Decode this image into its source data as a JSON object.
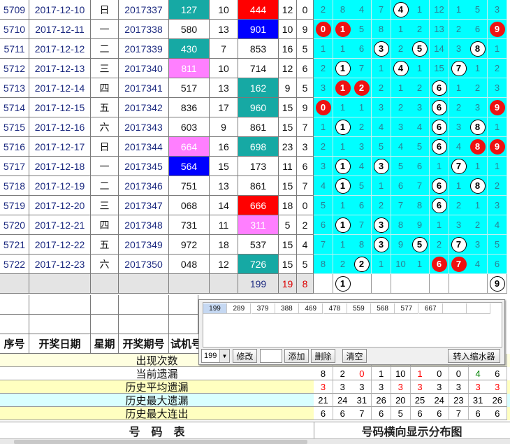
{
  "rows": [
    {
      "seq": "5709",
      "date": "2017-12-10",
      "week": "日",
      "period": "2017337",
      "t1": "127",
      "t1c": "teal",
      "t2": "10",
      "t3": "444",
      "t3c": "red",
      "s": "12",
      "k": "0",
      "dist": [
        {
          "v": "2"
        },
        {
          "v": "8"
        },
        {
          "v": "4"
        },
        {
          "v": "7"
        },
        {
          "v": "4",
          "b": "w"
        },
        {
          "v": "1"
        },
        {
          "v": "12"
        },
        {
          "v": "1"
        },
        {
          "v": "5"
        },
        {
          "v": "3"
        }
      ]
    },
    {
      "seq": "5710",
      "date": "2017-12-11",
      "week": "一",
      "period": "2017338",
      "t1": "580",
      "t1c": "",
      "t2": "13",
      "t3": "901",
      "t3c": "blue",
      "s": "10",
      "k": "9",
      "dist": [
        {
          "v": "0",
          "b": "r"
        },
        {
          "v": "1",
          "b": "r"
        },
        {
          "v": "5"
        },
        {
          "v": "8"
        },
        {
          "v": "1"
        },
        {
          "v": "2"
        },
        {
          "v": "13"
        },
        {
          "v": "2"
        },
        {
          "v": "6"
        },
        {
          "v": "9",
          "b": "r"
        }
      ]
    },
    {
      "seq": "5711",
      "date": "2017-12-12",
      "week": "二",
      "period": "2017339",
      "t1": "430",
      "t1c": "teal",
      "t2": "7",
      "t3": "853",
      "t3c": "",
      "s": "16",
      "k": "5",
      "dist": [
        {
          "v": "1"
        },
        {
          "v": "1"
        },
        {
          "v": "6"
        },
        {
          "v": "3",
          "b": "w"
        },
        {
          "v": "2"
        },
        {
          "v": "5",
          "b": "w"
        },
        {
          "v": "14"
        },
        {
          "v": "3"
        },
        {
          "v": "8",
          "b": "w"
        },
        {
          "v": "1"
        }
      ]
    },
    {
      "seq": "5712",
      "date": "2017-12-13",
      "week": "三",
      "period": "2017340",
      "t1": "811",
      "t1c": "pink",
      "t2": "10",
      "t3": "714",
      "t3c": "",
      "s": "12",
      "k": "6",
      "dist": [
        {
          "v": "2"
        },
        {
          "v": "1",
          "b": "w"
        },
        {
          "v": "7"
        },
        {
          "v": "1"
        },
        {
          "v": "4",
          "b": "w"
        },
        {
          "v": "1"
        },
        {
          "v": "15"
        },
        {
          "v": "7",
          "b": "w"
        },
        {
          "v": "1"
        },
        {
          "v": "2"
        }
      ]
    },
    {
      "seq": "5713",
      "date": "2017-12-14",
      "week": "四",
      "period": "2017341",
      "t1": "517",
      "t1c": "",
      "t2": "13",
      "t3": "162",
      "t3c": "teal",
      "s": "9",
      "k": "5",
      "dist": [
        {
          "v": "3"
        },
        {
          "v": "1",
          "b": "r"
        },
        {
          "v": "2",
          "b": "r"
        },
        {
          "v": "2"
        },
        {
          "v": "1"
        },
        {
          "v": "2"
        },
        {
          "v": "6",
          "b": "w"
        },
        {
          "v": "1"
        },
        {
          "v": "2"
        },
        {
          "v": "3"
        }
      ]
    },
    {
      "seq": "5714",
      "date": "2017-12-15",
      "week": "五",
      "period": "2017342",
      "t1": "836",
      "t1c": "",
      "t2": "17",
      "t3": "960",
      "t3c": "teal",
      "s": "15",
      "k": "9",
      "dist": [
        {
          "v": "0",
          "b": "r"
        },
        {
          "v": "1"
        },
        {
          "v": "1"
        },
        {
          "v": "3"
        },
        {
          "v": "2"
        },
        {
          "v": "3"
        },
        {
          "v": "6",
          "b": "w"
        },
        {
          "v": "2"
        },
        {
          "v": "3"
        },
        {
          "v": "9",
          "b": "r"
        }
      ]
    },
    {
      "seq": "5715",
      "date": "2017-12-16",
      "week": "六",
      "period": "2017343",
      "t1": "603",
      "t1c": "",
      "t2": "9",
      "t3": "861",
      "t3c": "",
      "s": "15",
      "k": "7",
      "dist": [
        {
          "v": "1"
        },
        {
          "v": "1",
          "b": "w"
        },
        {
          "v": "2"
        },
        {
          "v": "4"
        },
        {
          "v": "3"
        },
        {
          "v": "4"
        },
        {
          "v": "6",
          "b": "w"
        },
        {
          "v": "3"
        },
        {
          "v": "8",
          "b": "w"
        },
        {
          "v": "1"
        }
      ]
    },
    {
      "seq": "5716",
      "date": "2017-12-17",
      "week": "日",
      "period": "2017344",
      "t1": "664",
      "t1c": "pink",
      "t2": "16",
      "t3": "698",
      "t3c": "teal",
      "s": "23",
      "k": "3",
      "dist": [
        {
          "v": "2"
        },
        {
          "v": "1"
        },
        {
          "v": "3"
        },
        {
          "v": "5"
        },
        {
          "v": "4"
        },
        {
          "v": "5"
        },
        {
          "v": "6",
          "b": "w"
        },
        {
          "v": "4"
        },
        {
          "v": "8",
          "b": "r"
        },
        {
          "v": "9",
          "b": "r"
        }
      ]
    },
    {
      "seq": "5717",
      "date": "2017-12-18",
      "week": "一",
      "period": "2017345",
      "t1": "564",
      "t1c": "blue",
      "t2": "15",
      "t3": "173",
      "t3c": "",
      "s": "11",
      "k": "6",
      "dist": [
        {
          "v": "3"
        },
        {
          "v": "1",
          "b": "w"
        },
        {
          "v": "4"
        },
        {
          "v": "3",
          "b": "w"
        },
        {
          "v": "5"
        },
        {
          "v": "6"
        },
        {
          "v": "1"
        },
        {
          "v": "7",
          "b": "w"
        },
        {
          "v": "1"
        },
        {
          "v": "1"
        }
      ]
    },
    {
      "seq": "5718",
      "date": "2017-12-19",
      "week": "二",
      "period": "2017346",
      "t1": "751",
      "t1c": "",
      "t2": "13",
      "t3": "861",
      "t3c": "",
      "s": "15",
      "k": "7",
      "dist": [
        {
          "v": "4"
        },
        {
          "v": "1",
          "b": "w"
        },
        {
          "v": "5"
        },
        {
          "v": "1"
        },
        {
          "v": "6"
        },
        {
          "v": "7"
        },
        {
          "v": "6",
          "b": "w"
        },
        {
          "v": "1"
        },
        {
          "v": "8",
          "b": "w"
        },
        {
          "v": "2"
        }
      ]
    },
    {
      "seq": "5719",
      "date": "2017-12-20",
      "week": "三",
      "period": "2017347",
      "t1": "068",
      "t1c": "",
      "t2": "14",
      "t3": "666",
      "t3c": "red",
      "s": "18",
      "k": "0",
      "dist": [
        {
          "v": "5"
        },
        {
          "v": "1"
        },
        {
          "v": "6"
        },
        {
          "v": "2"
        },
        {
          "v": "7"
        },
        {
          "v": "8"
        },
        {
          "v": "6",
          "b": "w"
        },
        {
          "v": "2"
        },
        {
          "v": "1"
        },
        {
          "v": "3"
        }
      ]
    },
    {
      "seq": "5720",
      "date": "2017-12-21",
      "week": "四",
      "period": "2017348",
      "t1": "731",
      "t1c": "",
      "t2": "11",
      "t3": "311",
      "t3c": "pink",
      "s": "5",
      "k": "2",
      "dist": [
        {
          "v": "6"
        },
        {
          "v": "1",
          "b": "w"
        },
        {
          "v": "7"
        },
        {
          "v": "3",
          "b": "w"
        },
        {
          "v": "8"
        },
        {
          "v": "9"
        },
        {
          "v": "1"
        },
        {
          "v": "3"
        },
        {
          "v": "2"
        },
        {
          "v": "4"
        }
      ]
    },
    {
      "seq": "5721",
      "date": "2017-12-22",
      "week": "五",
      "period": "2017349",
      "t1": "972",
      "t1c": "",
      "t2": "18",
      "t3": "537",
      "t3c": "",
      "s": "15",
      "k": "4",
      "dist": [
        {
          "v": "7"
        },
        {
          "v": "1"
        },
        {
          "v": "8"
        },
        {
          "v": "3",
          "b": "w"
        },
        {
          "v": "9"
        },
        {
          "v": "5",
          "b": "w"
        },
        {
          "v": "2"
        },
        {
          "v": "7",
          "b": "w"
        },
        {
          "v": "3"
        },
        {
          "v": "5"
        }
      ]
    },
    {
      "seq": "5722",
      "date": "2017-12-23",
      "week": "六",
      "period": "2017350",
      "t1": "048",
      "t1c": "",
      "t2": "12",
      "t3": "726",
      "t3c": "teal",
      "s": "15",
      "k": "5",
      "dist": [
        {
          "v": "8"
        },
        {
          "v": "2"
        },
        {
          "v": "2",
          "b": "w"
        },
        {
          "v": "1"
        },
        {
          "v": "10"
        },
        {
          "v": "1"
        },
        {
          "v": "6",
          "b": "r"
        },
        {
          "v": "7",
          "b": "r"
        },
        {
          "v": "4"
        },
        {
          "v": "6"
        }
      ]
    }
  ],
  "summary_row": {
    "t3": "199",
    "s": "19",
    "k": "8",
    "balls": [
      {
        "col": 1,
        "v": "1"
      },
      {
        "col": 9,
        "v": "9"
      }
    ]
  },
  "header": [
    "序号",
    "开奖日期",
    "星期",
    "开奖期号",
    "试机号"
  ],
  "stats": [
    {
      "label": "出现次数",
      "bg": "#ffffe0",
      "values": [],
      "colors": []
    },
    {
      "label": "当前遗漏",
      "bg": "#ffffff",
      "values": [
        "8",
        "2",
        "0",
        "1",
        "10",
        "1",
        "0",
        "0",
        "4",
        "6"
      ],
      "colors": [
        "#000000",
        "#000000",
        "#ff0000",
        "#000000",
        "#000000",
        "#ff0000",
        "#000000",
        "#000000",
        "#008000",
        "#000000"
      ]
    },
    {
      "label": "历史平均遗漏",
      "bg": "#ffffc0",
      "values": [
        "3",
        "3",
        "3",
        "3",
        "3",
        "3",
        "3",
        "3",
        "3",
        "3"
      ],
      "colors": [
        "#ff0000",
        "#000000",
        "#000000",
        "#000000",
        "#ff0000",
        "#ff0000",
        "#000000",
        "#000000",
        "#ff0000",
        "#ff0000"
      ]
    },
    {
      "label": "历史最大遗漏",
      "bg": "#d9ffff",
      "values": [
        "21",
        "24",
        "31",
        "26",
        "20",
        "25",
        "24",
        "23",
        "31",
        "26"
      ],
      "colors": [
        "#000000",
        "#000000",
        "#000000",
        "#000000",
        "#000000",
        "#000000",
        "#000000",
        "#000000",
        "#000000",
        "#000000"
      ]
    },
    {
      "label": "历史最大连出",
      "bg": "#ffffc0",
      "values": [
        "6",
        "6",
        "7",
        "6",
        "5",
        "6",
        "6",
        "7",
        "6",
        "6"
      ],
      "colors": [
        "#000000",
        "#000000",
        "#000000",
        "#000000",
        "#000000",
        "#000000",
        "#000000",
        "#000000",
        "#000000",
        "#000000"
      ]
    }
  ],
  "footer": {
    "left_title": "号　码　表",
    "right_title": "号码横向显示分布图"
  },
  "panel": {
    "numbers": [
      "199",
      "289",
      "379",
      "388",
      "469",
      "478",
      "559",
      "568",
      "577",
      "667",
      "",
      ""
    ],
    "select_value": "199",
    "buttons": {
      "modify": "修改",
      "add": "添加",
      "delete": "删除",
      "clear": "清空",
      "transfer": "转入缩水器"
    }
  },
  "colors": {
    "dist_bg": "#00ffff",
    "teal": "#16a9a4",
    "pink": "#ff7fff",
    "blue": "#0000ff",
    "red": "#ff0000"
  }
}
